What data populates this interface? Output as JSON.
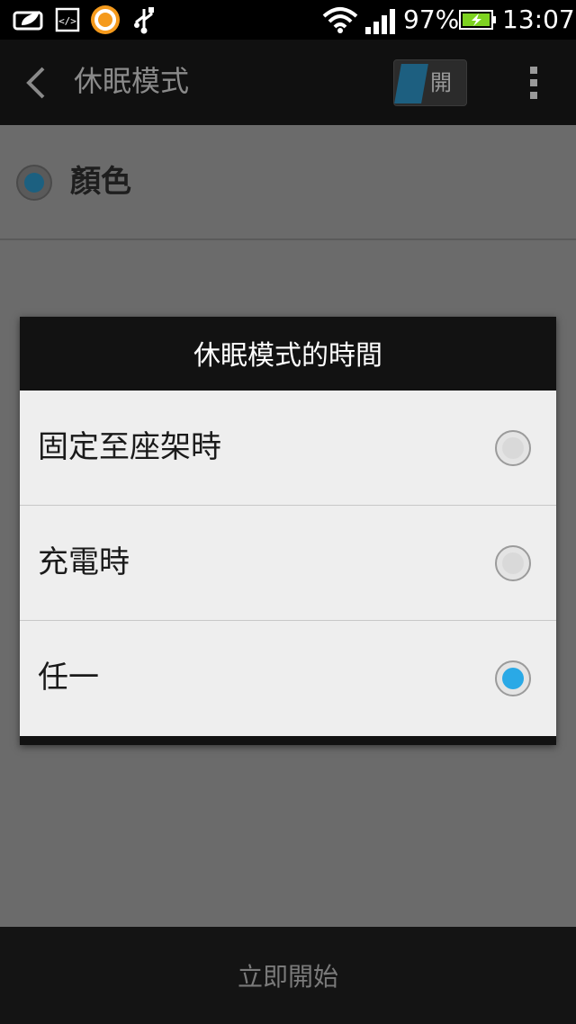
{
  "status_bar": {
    "battery_percent": "97%",
    "time": "13:07",
    "icons": [
      "leaf-notification-icon",
      "code-icon",
      "music-app-icon",
      "usb-icon",
      "wifi-icon",
      "signal-icon",
      "battery-charging-icon"
    ]
  },
  "action_bar": {
    "title": "休眠模式",
    "toggle_label": "開"
  },
  "setting_row": {
    "label": "顏色"
  },
  "dialog": {
    "title": "休眠模式的時間",
    "options": [
      {
        "label": "固定至座架時",
        "selected": false
      },
      {
        "label": "充電時",
        "selected": false
      },
      {
        "label": "任一",
        "selected": true
      }
    ]
  },
  "bottom_bar": {
    "label": "立即開始"
  },
  "colors": {
    "accent": "#2aa9e6",
    "toggle_on": "#1d5f80",
    "dialog_bg": "#eeeeee"
  }
}
